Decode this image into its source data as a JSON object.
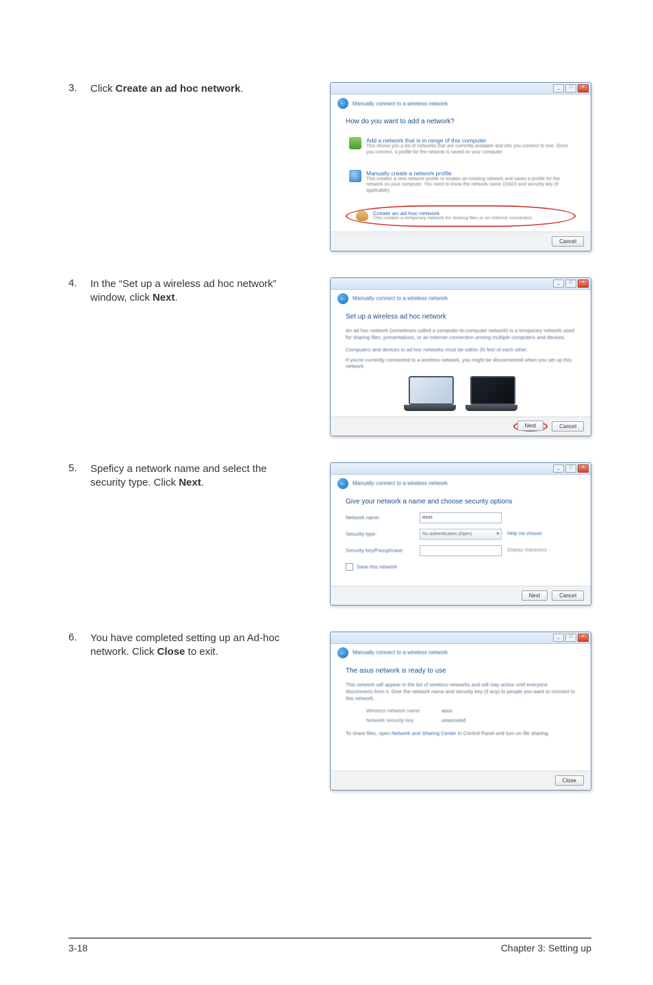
{
  "steps": {
    "s3": {
      "num": "3.",
      "pre": "Click ",
      "bold": "Create an ad hoc network",
      "post": "."
    },
    "s4": {
      "num": "4.",
      "pre": "In the “Set up a wireless ad hoc network” window, click ",
      "bold": "Next",
      "post": "."
    },
    "s5": {
      "num": "5.",
      "pre": "Speficy a network name and select the security type. Click ",
      "bold": "Next",
      "post": "."
    },
    "s6": {
      "num": "6.",
      "pre": "You have completed setting up an Ad-hoc network. Click ",
      "bold": "Close",
      "post": " to exit."
    }
  },
  "titlebar": {
    "min": "_",
    "max": "□",
    "close": "×"
  },
  "crumb": {
    "arrow": "←",
    "text": "Manually connect to a wireless network"
  },
  "dlg1": {
    "heading": "How do you want to add a network?",
    "opt1": {
      "title": "Add a network that is in range of this computer",
      "desc": "This shows you a list of networks that are currently available and lets you connect to one. Once you connect, a profile for the network is saved on your computer."
    },
    "opt2": {
      "title": "Manually create a network profile",
      "desc": "This creates a new network profile or locates an existing network and saves a profile for the network on your computer. You need to know the network name (SSID) and security key (if applicable)."
    },
    "opt3": {
      "title": "Create an ad hoc network",
      "desc": "This creates a temporary network for sharing files or an Internet connection"
    },
    "cancel": "Cancel"
  },
  "dlg2": {
    "heading": "Set up a wireless ad hoc network",
    "para": "An ad hoc network (sometimes called a computer-to-computer network) is a temporary network used for sharing files, presentations, or an Internet connection among multiple computers and devices.",
    "line1": "Computers and devices in ad hoc networks must be within 30 feet of each other.",
    "line2": "If you're currently connected to a wireless network, you might be disconnected when you set up this network.",
    "next": "Next",
    "cancel": "Cancel"
  },
  "dlg3": {
    "heading": "Give your network a name and choose security options",
    "name_label": "Network name:",
    "name_value": "asus",
    "type_label": "Security type:",
    "type_value": "No authentication (Open)",
    "type_link": "Help me choose",
    "key_label": "Security key/Passphrase:",
    "key_note": "Display characters",
    "save_chk": "Save this network",
    "next": "Next",
    "cancel": "Cancel"
  },
  "dlg4": {
    "heading": "The asus network is ready to use",
    "para": "This network will appear in the list of wireless networks and will stay active until everyone disconnects from it. Give the network name and security key (if any) to people you want to connect to this network.",
    "name_label": "Wireless network name:",
    "name_value": "asus",
    "key_label": "Network security key:",
    "key_value": "unsecured",
    "share_pre": "To share files, open ",
    "share_link": "Network and Sharing Center",
    "share_post": " in Control Panel and turn on file sharing.",
    "close": "Close"
  },
  "footer": {
    "left": "3-18",
    "right": "Chapter 3: Setting up"
  }
}
